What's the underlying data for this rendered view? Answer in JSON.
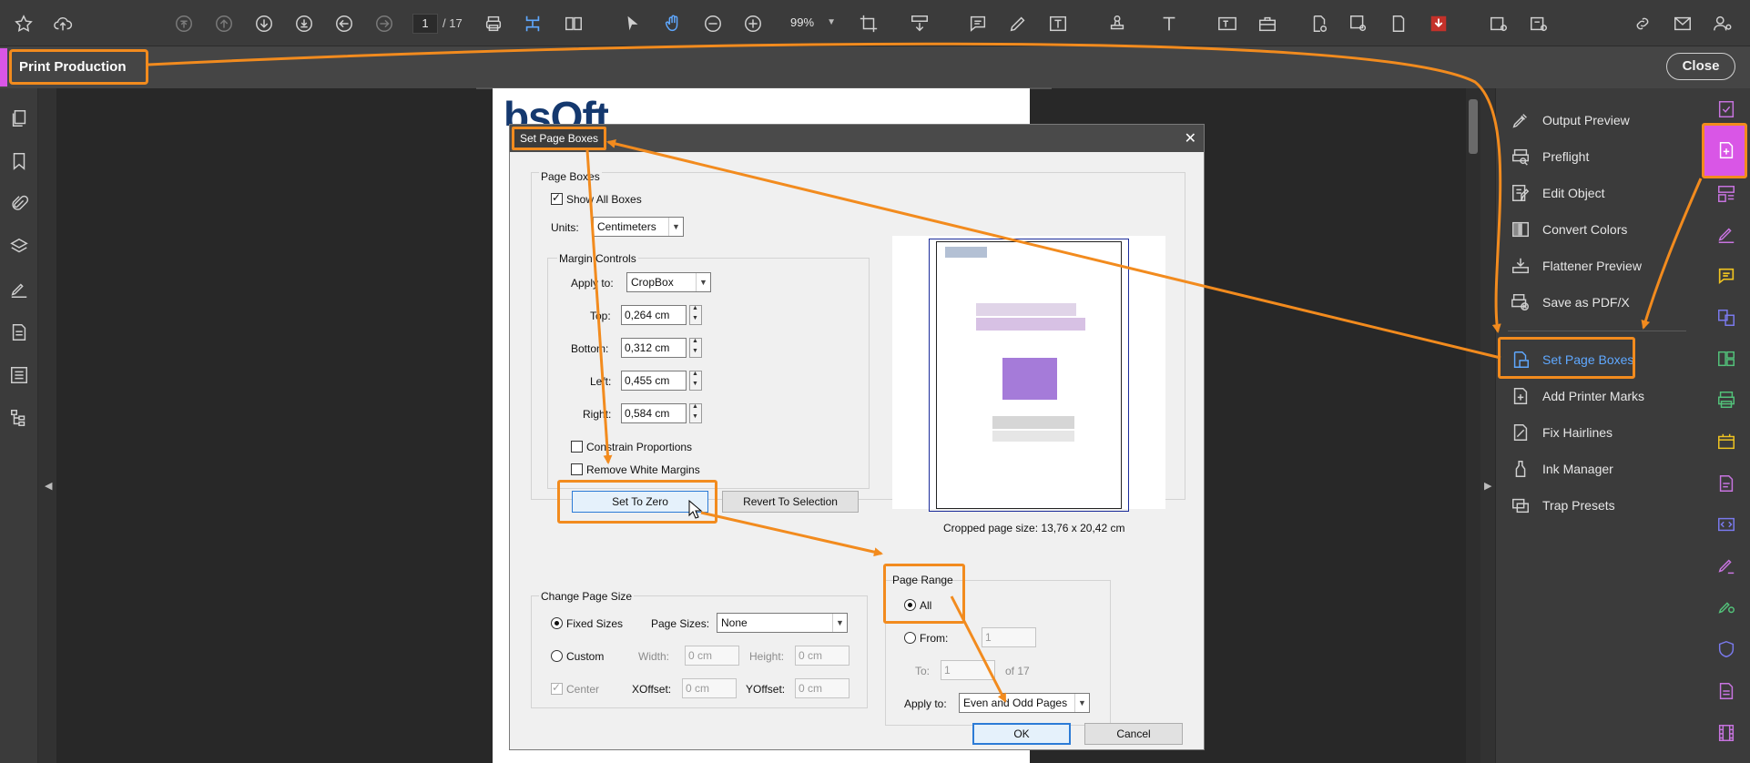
{
  "toolbar": {
    "page_current": "1",
    "page_total": "/ 17",
    "zoom": "99%"
  },
  "secondary_bar": {
    "tool_title": "Print Production",
    "close_label": "Close"
  },
  "right_panel": {
    "items": [
      {
        "label": "Output Preview",
        "icon": "output-preview-icon"
      },
      {
        "label": "Preflight",
        "icon": "preflight-icon"
      },
      {
        "label": "Edit Object",
        "icon": "edit-object-icon"
      },
      {
        "label": "Convert Colors",
        "icon": "convert-colors-icon"
      },
      {
        "label": "Flattener Preview",
        "icon": "flattener-preview-icon"
      },
      {
        "label": "Save as PDF/X",
        "icon": "save-pdfx-icon"
      },
      {
        "label": "Set Page Boxes",
        "icon": "set-page-boxes-icon"
      },
      {
        "label": "Add Printer Marks",
        "icon": "add-printer-marks-icon"
      },
      {
        "label": "Fix Hairlines",
        "icon": "fix-hairlines-icon"
      },
      {
        "label": "Ink Manager",
        "icon": "ink-manager-icon"
      },
      {
        "label": "Trap Presets",
        "icon": "trap-presets-icon"
      }
    ]
  },
  "document": {
    "logo_text": "bsOft"
  },
  "dialog": {
    "title": "Set Page Boxes",
    "page_boxes": {
      "group_label": "Page Boxes",
      "show_all_boxes_label": "Show All Boxes",
      "show_all_boxes_checked": true,
      "units_label": "Units:",
      "units_value": "Centimeters",
      "margin_controls": {
        "group_label": "Margin Controls",
        "apply_to_label": "Apply to:",
        "apply_to_value": "CropBox",
        "top_label": "Top:",
        "top_value": "0,264 cm",
        "bottom_label": "Bottom:",
        "bottom_value": "0,312 cm",
        "left_label": "Left:",
        "left_value": "0,455 cm",
        "right_label": "Right:",
        "right_value": "0,584 cm",
        "constrain_label": "Constrain Proportions",
        "constrain_checked": false,
        "remove_white_label": "Remove White Margins",
        "remove_white_checked": false,
        "set_to_zero_label": "Set To Zero",
        "revert_label": "Revert To Selection"
      },
      "cropped_size_text": "Cropped page size: 13,76 x 20,42 cm"
    },
    "change_page_size": {
      "group_label": "Change Page Size",
      "fixed_sizes_label": "Fixed Sizes",
      "fixed_selected": true,
      "page_sizes_label": "Page Sizes:",
      "page_sizes_value": "None",
      "custom_label": "Custom",
      "width_label": "Width:",
      "width_value": "0 cm",
      "height_label": "Height:",
      "height_value": "0 cm",
      "center_label": "Center",
      "xoffset_label": "XOffset:",
      "xoffset_value": "0 cm",
      "yoffset_label": "YOffset:",
      "yoffset_value": "0 cm"
    },
    "page_range": {
      "group_label": "Page Range",
      "all_label": "All",
      "all_selected": true,
      "from_label": "From:",
      "from_value": "1",
      "to_label": "To:",
      "to_value": "1",
      "of_label": "of 17",
      "apply_to_label": "Apply to:",
      "apply_to_value": "Even and Odd Pages"
    },
    "ok_label": "OK",
    "cancel_label": "Cancel"
  },
  "colors": {
    "highlight_orange": "#f28b1e",
    "accent_magenta": "#d956e6",
    "link_blue": "#5fa8ff"
  }
}
